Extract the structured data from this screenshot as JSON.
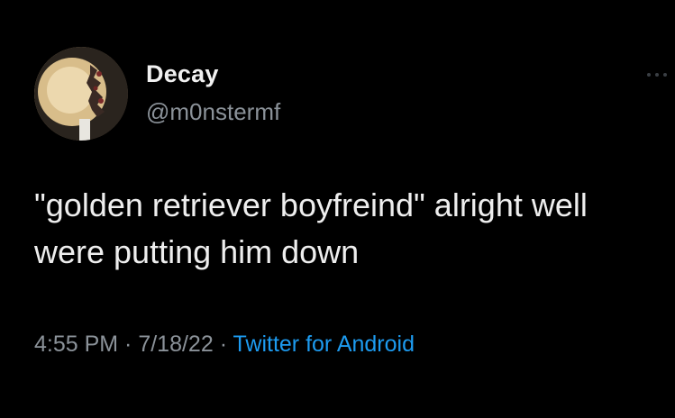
{
  "author": {
    "display_name": "Decay",
    "handle": "@m0nstermf"
  },
  "tweet": {
    "text": "\"golden retriever boyfreind\" alright well were putting him down",
    "time": "4:55 PM",
    "separator": " · ",
    "date": "7/18/22",
    "source": "Twitter for Android"
  },
  "icons": {
    "more": "more-dots-icon",
    "avatar": "avatar-image"
  },
  "colors": {
    "background": "#000000",
    "text": "#eeeeee",
    "secondary_text": "#8b9299",
    "link": "#1d9bf0"
  }
}
